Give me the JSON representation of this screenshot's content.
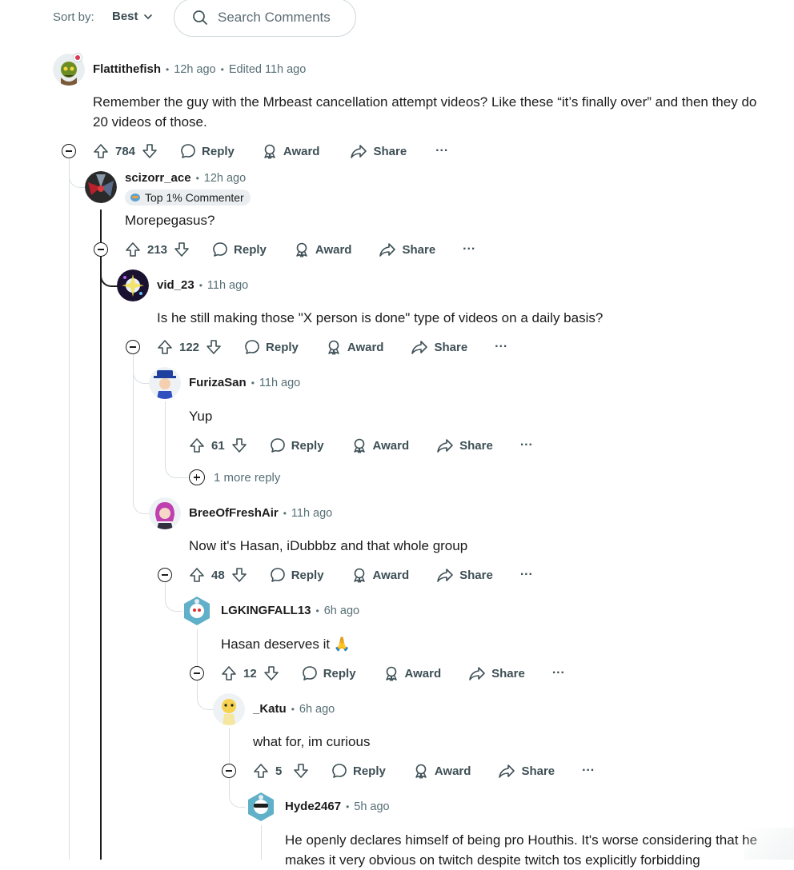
{
  "toolbar": {
    "sort_label": "Sort by:",
    "sort_value": "Best",
    "search_placeholder": "Search Comments"
  },
  "comments": [
    {
      "user": "Flattithefish",
      "time": "12h ago",
      "edited": "Edited 11h ago",
      "body": "Remember the guy with the Mrbeast cancellation attempt videos? Like these “it’s finally over” and then they do 20 videos of those.",
      "votes": "784",
      "reply_label": "Reply",
      "award_label": "Award",
      "share_label": "Share"
    },
    {
      "user": "scizorr_ace",
      "time": "12h ago",
      "flair": "Top 1% Commenter",
      "body": "Morepegasus?",
      "votes": "213",
      "reply_label": "Reply",
      "award_label": "Award",
      "share_label": "Share"
    },
    {
      "user": "vid_23",
      "time": "11h ago",
      "body": "Is he still making those \"X person is done\" type of videos on a daily basis?",
      "votes": "122",
      "reply_label": "Reply",
      "award_label": "Award",
      "share_label": "Share"
    },
    {
      "user": "FurizaSan",
      "time": "11h ago",
      "body": "Yup",
      "votes": "61",
      "reply_label": "Reply",
      "award_label": "Award",
      "share_label": "Share",
      "more_replies": "1 more reply"
    },
    {
      "user": "BreeOfFreshAir",
      "time": "11h ago",
      "body": "Now it's Hasan, iDubbbz and that whole group",
      "votes": "48",
      "reply_label": "Reply",
      "award_label": "Award",
      "share_label": "Share"
    },
    {
      "user": "LGKINGFALL13",
      "time": "6h ago",
      "body": "Hasan deserves it 🙏",
      "votes": "12",
      "reply_label": "Reply",
      "award_label": "Award",
      "share_label": "Share"
    },
    {
      "user": "_Katu",
      "time": "6h ago",
      "body": "what for, im curious",
      "votes": "5",
      "reply_label": "Reply",
      "award_label": "Award",
      "share_label": "Share"
    },
    {
      "user": "Hyde2467",
      "time": "5h ago",
      "body": "He openly declares himself of being pro Houthis. It's worse considering that he makes it very obvious on twitch despite twitch tos explicitly forbidding"
    }
  ],
  "colors": {
    "text": "#1c1c1c",
    "meta": "#576f76",
    "thread_line": "#d8dfe2",
    "active_thread": "#1c1c1c"
  }
}
